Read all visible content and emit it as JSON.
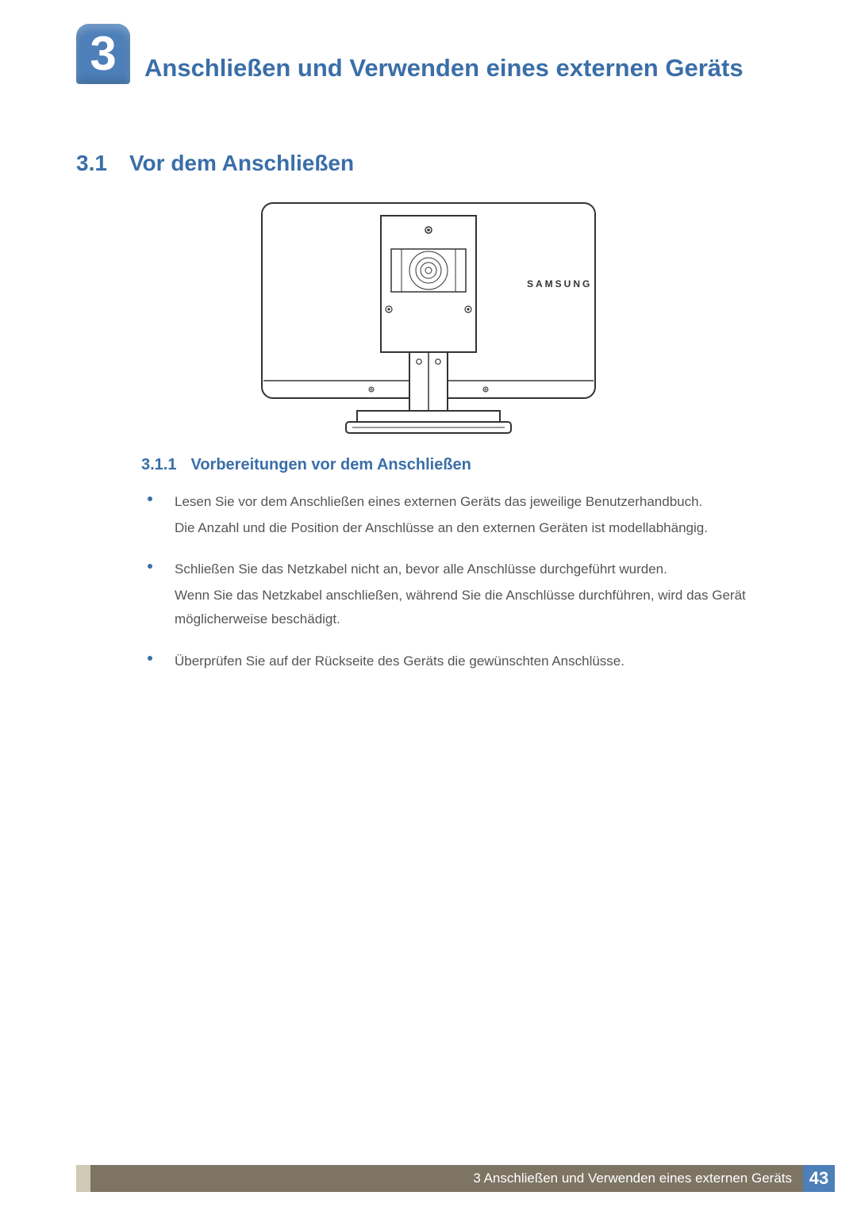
{
  "chapter": {
    "number": "3",
    "title": "Anschließen und Verwenden eines externen Geräts"
  },
  "section": {
    "number": "3.1",
    "title": "Vor dem Anschließen"
  },
  "figure": {
    "brand": "SAMSUNG"
  },
  "subsection": {
    "number": "3.1.1",
    "title": "Vorbereitungen vor dem Anschließen"
  },
  "bullets": [
    {
      "line1": "Lesen Sie vor dem Anschließen eines externen Geräts das jeweilige Benutzerhandbuch.",
      "line2": "Die Anzahl und die Position der Anschlüsse an den externen Geräten ist modellabhängig."
    },
    {
      "line1": "Schließen Sie das Netzkabel nicht an, bevor alle Anschlüsse durchgeführt wurden.",
      "line2": "Wenn Sie das Netzkabel anschließen, während Sie die Anschlüsse durchführen, wird das Gerät möglicherweise beschädigt."
    },
    {
      "line1": "Überprüfen Sie auf der Rückseite des Geräts die gewünschten Anschlüsse.",
      "line2": ""
    }
  ],
  "footer": {
    "caption": "3 Anschließen und Verwenden eines externen Geräts",
    "page_number": "43"
  }
}
